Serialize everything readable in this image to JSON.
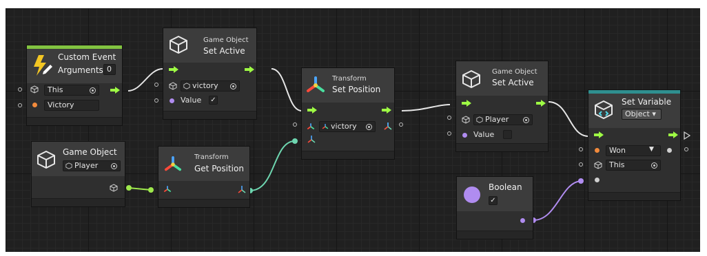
{
  "colors": {
    "flow": "#9efc44",
    "object": "#9ee84c",
    "string": "#f28a3c",
    "boolean": "#b08cf0",
    "vector": "#6ed6b0",
    "wire": "#e6e6e6",
    "header": "#3c3c3c",
    "event_stripe": "#82c341",
    "variable_stripe": "#2f8f8f"
  },
  "nodes": {
    "custom_event": {
      "title": "Custom Event",
      "args_label": "Arguments",
      "args_count": "0",
      "target": "This",
      "name_value": "Victory",
      "icon": "lightning-pencil-icon"
    },
    "set_active_1": {
      "subtitle": "Game Object",
      "title": "Set Active",
      "target": "victory",
      "value_label": "Value",
      "value": "✓",
      "icon": "cube-icon"
    },
    "set_position": {
      "subtitle": "Transform",
      "title": "Set Position",
      "target": "victory",
      "icon": "transform-axes-icon"
    },
    "set_active_2": {
      "subtitle": "Game Object",
      "title": "Set Active",
      "target": "Player",
      "value_label": "Value",
      "value": "",
      "icon": "cube-icon"
    },
    "set_variable": {
      "title": "Set Variable",
      "kind": "Object ▾",
      "name": "Won",
      "target": "This",
      "icon": "variable-cube-icon"
    },
    "game_object": {
      "subtitle": "Game Object",
      "target": "Player",
      "icon": "cube-icon"
    },
    "get_position": {
      "subtitle": "Transform",
      "title": "Get Position",
      "icon": "transform-axes-icon"
    },
    "boolean": {
      "title": "Boolean",
      "value": "✓"
    }
  }
}
